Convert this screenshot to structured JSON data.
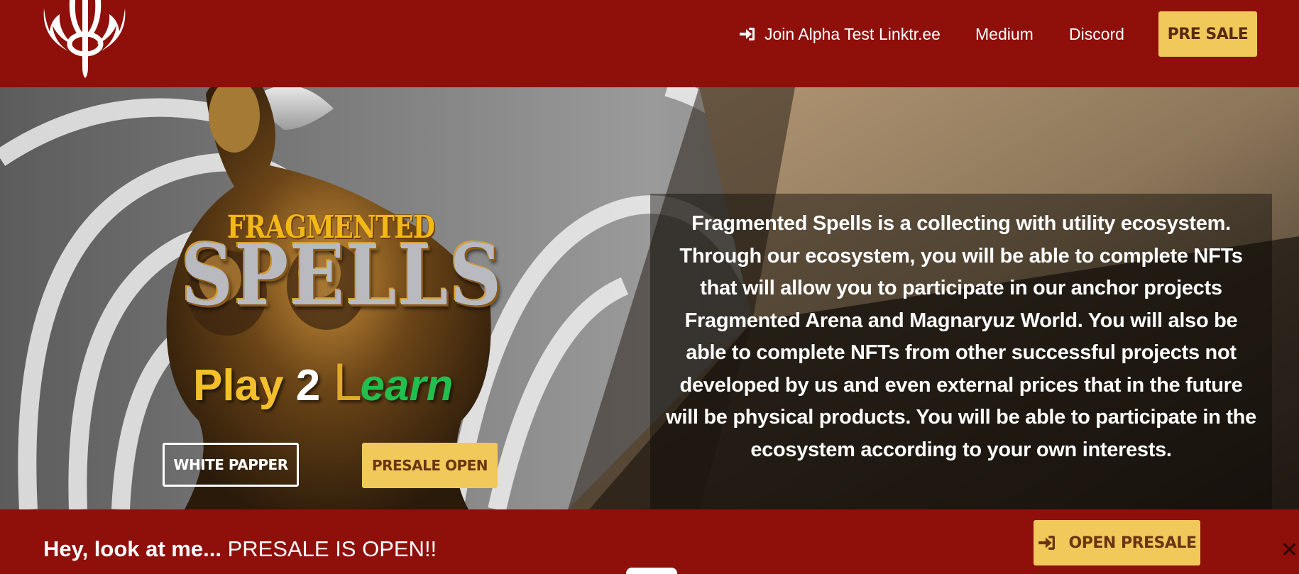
{
  "header": {
    "nav": {
      "join_alpha": "Join Alpha Test",
      "linktree": "Linktr.ee",
      "medium": "Medium",
      "discord": "Discord"
    },
    "presale_button": "PRE SALE",
    "logo_icon": "trident-wings-logo",
    "join_icon": "sign-in-icon"
  },
  "hero": {
    "title_top": "FRAGMENTED",
    "title_main": "SPELLS",
    "tagline": {
      "play": "Play",
      "two": "2",
      "l": "L",
      "earn": "earn"
    },
    "white_paper_button": "WHITE PAPPER",
    "presale_open_button": "PRESALE OPEN",
    "description": "Fragmented Spells is a collecting with utility ecosystem. Through our ecosystem, you will be able to complete NFTs that will allow you to participate in our anchor projects Fragmented Arena and Magnaryuz World. You will also be able to complete NFTs from other successful projects not developed by us and even external prices that in the future will be physical products. You will be able to participate in the ecosystem according to your own interests."
  },
  "banner": {
    "lead": "Hey, look at me...",
    "message": " PRESALE IS OPEN!!",
    "button": "OPEN PRESALE",
    "button_icon": "sign-in-icon",
    "close": "✕"
  },
  "colors": {
    "brand_red": "#8f0f0a",
    "accent_gold": "#f0c95a",
    "button_text_brown": "#6b3411",
    "tagline_yellow": "#f3c02b",
    "tagline_green": "#21bf4d"
  }
}
